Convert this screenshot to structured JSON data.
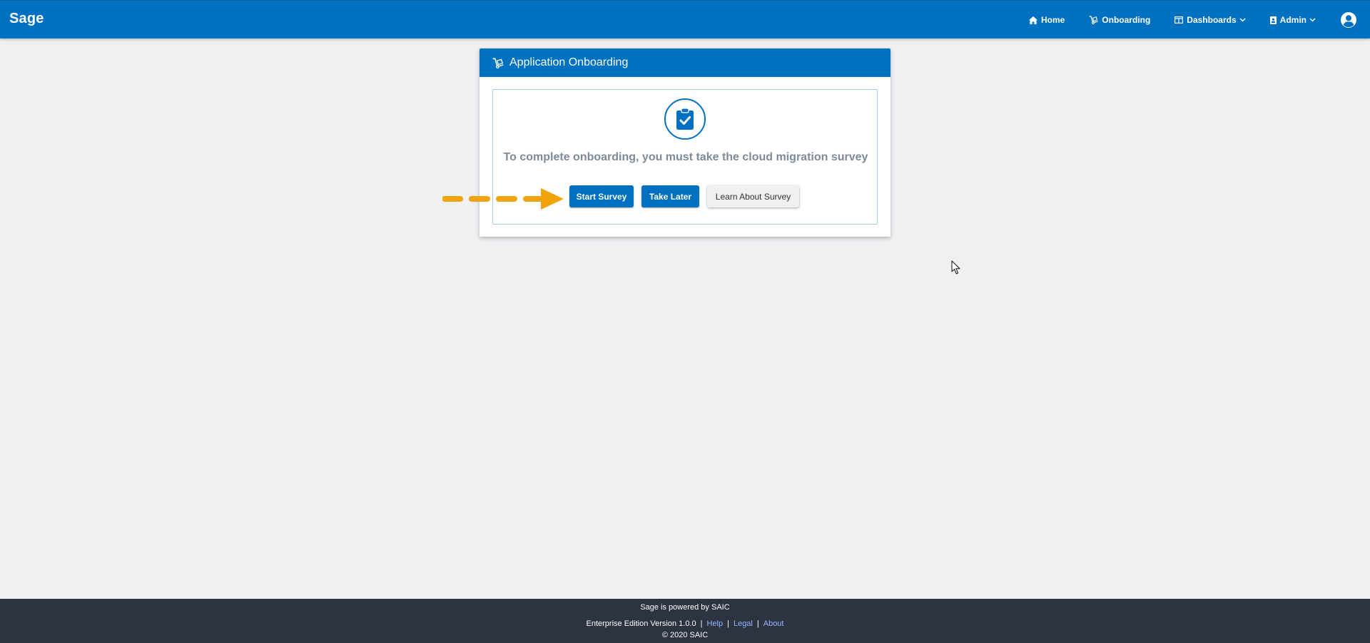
{
  "app": {
    "title": "Sage"
  },
  "nav": {
    "home": "Home",
    "onboarding": "Onboarding",
    "dashboards": "Dashboards",
    "admin": "Admin"
  },
  "card": {
    "title": "Application Onboarding",
    "message": "To complete onboarding, you must take the cloud migration survey",
    "buttons": {
      "start": "Start Survey",
      "later": "Take Later",
      "learn": "Learn About Survey"
    }
  },
  "footer": {
    "powered": "Sage is powered by SAIC",
    "version": "Enterprise Edition Version 1.0.0",
    "sep": "|",
    "help": "Help",
    "legal": "Legal",
    "about": "About",
    "copyright": "© 2020 SAIC"
  },
  "colors": {
    "brand": "#0070c0",
    "footer_bg": "#2d3340",
    "annotation_arrow": "#f0a30a",
    "link": "#8fb8ff"
  },
  "icons": {
    "home": "home-icon",
    "onboarding": "dolly-icon",
    "dashboards": "columns-icon",
    "admin": "id-badge-icon",
    "avatar": "user-circle-icon",
    "clipboard": "clipboard-check-icon"
  }
}
